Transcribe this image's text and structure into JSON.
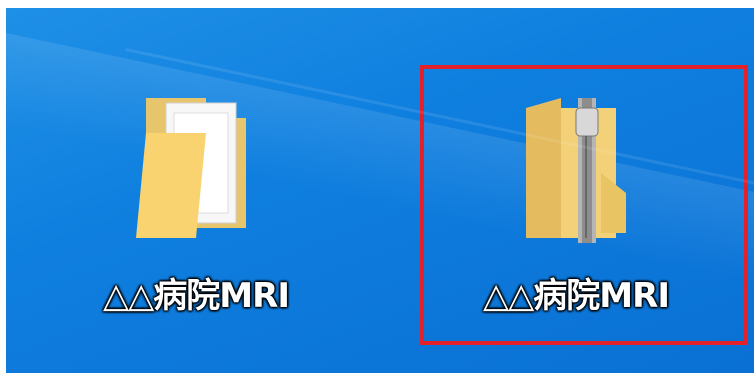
{
  "desktop": {
    "icons": [
      {
        "label": "△△病院MRI",
        "type": "folder",
        "icon": "folder-icon"
      },
      {
        "label": "△△病院MRI",
        "type": "zip-folder",
        "icon": "zip-folder-icon"
      }
    ],
    "highlight_color": "#e3212b",
    "background_color": "#0f7fdf"
  }
}
